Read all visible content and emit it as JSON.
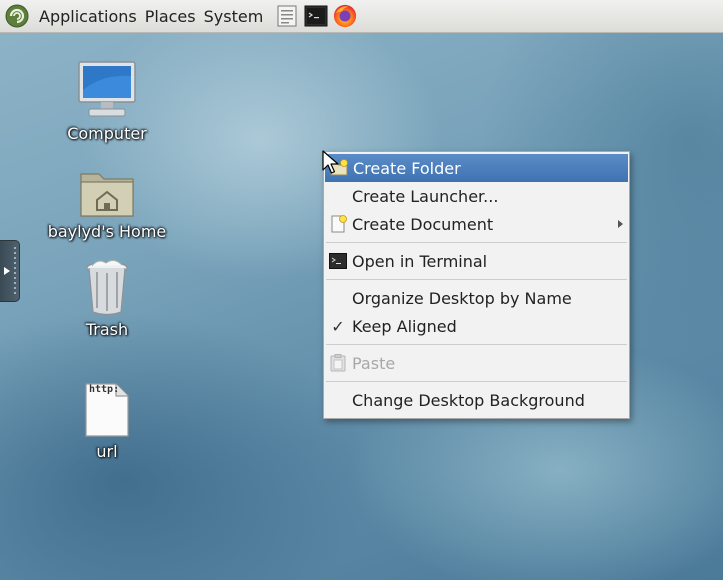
{
  "panel": {
    "menus": [
      "Applications",
      "Places",
      "System"
    ],
    "launchers": [
      "text-editor-icon",
      "terminal-icon",
      "firefox-icon"
    ]
  },
  "desktop": {
    "icons": [
      {
        "label": "Computer",
        "icon": "computer-icon"
      },
      {
        "label": "baylyd's Home",
        "icon": "home-folder-icon"
      },
      {
        "label": "Trash",
        "icon": "trash-icon"
      },
      {
        "label": "url",
        "icon": "url-file-icon",
        "file_text": "http:"
      }
    ]
  },
  "context_menu": {
    "items": [
      {
        "label": "Create Folder",
        "icon": "new-folder-icon",
        "highlighted": true
      },
      {
        "label": "Create Launcher..."
      },
      {
        "label": "Create Document",
        "icon": "new-document-icon",
        "submenu": true
      },
      {
        "label": "Open in Terminal",
        "icon": "terminal-icon"
      },
      {
        "label": "Organize Desktop by Name"
      },
      {
        "label": "Keep Aligned",
        "checked": true,
        "check_glyph": "✓"
      },
      {
        "label": "Paste",
        "icon": "paste-icon",
        "disabled": true
      },
      {
        "label": "Change Desktop Background"
      }
    ]
  },
  "colors": {
    "highlight": "#4a7fbf",
    "menu_bg": "#f2f2f2",
    "panel_bg": "#e6e6e3"
  }
}
